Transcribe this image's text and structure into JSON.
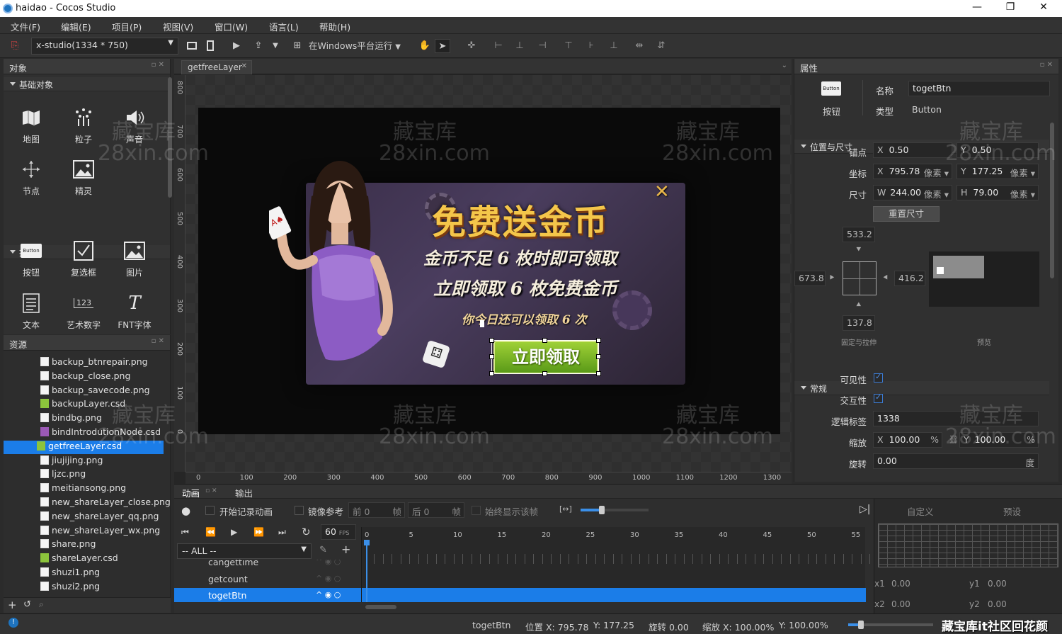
{
  "window": {
    "title": "haidao - Cocos Studio"
  },
  "menu": [
    "文件(F)",
    "编辑(E)",
    "项目(P)",
    "视图(V)",
    "窗口(W)",
    "语言(L)",
    "帮助(H)"
  ],
  "toolbar": {
    "resolution": "x-studio(1334 * 750)",
    "run_target": "在Windows平台运行"
  },
  "objects_panel": {
    "title": "对象",
    "basic_section": "基础对象",
    "basic_items": [
      "地图",
      "粒子",
      "声音",
      "节点",
      "精灵"
    ],
    "controls_section": "控件",
    "control_items": [
      "按钮",
      "复选框",
      "图片",
      "文本",
      "艺术数字",
      "FNT字体"
    ],
    "button_icon_text": "Button",
    "artnum_icon_text": "123"
  },
  "resources_panel": {
    "title": "资源",
    "files": [
      {
        "name": "backup_btnrepair.png",
        "type": "png"
      },
      {
        "name": "backup_close.png",
        "type": "png"
      },
      {
        "name": "backup_savecode.png",
        "type": "png"
      },
      {
        "name": "backupLayer.csd",
        "type": "csd"
      },
      {
        "name": "bindbg.png",
        "type": "png"
      },
      {
        "name": "bindIntrodutionNode.csd",
        "type": "csdp"
      },
      {
        "name": "getfreeLayer.csd",
        "type": "csd",
        "selected": true
      },
      {
        "name": "jiujijing.png",
        "type": "png"
      },
      {
        "name": "ljzc.png",
        "type": "png"
      },
      {
        "name": "meitiansong.png",
        "type": "png"
      },
      {
        "name": "new_shareLayer_close.png",
        "type": "png"
      },
      {
        "name": "new_shareLayer_qq.png",
        "type": "png"
      },
      {
        "name": "new_shareLayer_wx.png",
        "type": "png"
      },
      {
        "name": "share.png",
        "type": "png"
      },
      {
        "name": "shareLayer.csd",
        "type": "csd"
      },
      {
        "name": "shuzi1.png",
        "type": "png"
      },
      {
        "name": "shuzi2.png",
        "type": "png"
      }
    ]
  },
  "editor": {
    "tab": "getfreeLayer",
    "ruler_x": [
      "0",
      "100",
      "200",
      "300",
      "400",
      "500",
      "600",
      "700",
      "800",
      "900",
      "1000",
      "1100",
      "1200",
      "1300"
    ],
    "ruler_y": [
      "800",
      "700",
      "600",
      "500",
      "400",
      "300",
      "200",
      "100",
      "0"
    ],
    "popup": {
      "title": "免费送金币",
      "line1": "金币不足 6 枚时即可领取",
      "line2": "立即领取 6 枚免费金币",
      "line3": "你今日还可以领取 6 次",
      "button": "立即领取",
      "close": "✕"
    }
  },
  "watermark": {
    "line1": "藏宝库",
    "line2": "28xin.com"
  },
  "properties": {
    "title": "属性",
    "icon_text": "Button",
    "icon_label": "按钮",
    "name_label": "名称",
    "name_value": "togetBtn",
    "type_label": "类型",
    "type_value": "Button",
    "pos_section": "位置与尺寸",
    "anchor_label": "锚点",
    "anchor_x": "0.50",
    "anchor_y": "0.50",
    "pos_label": "坐标",
    "pos_x": "795.78",
    "pos_y": "177.25",
    "size_label": "尺寸",
    "size_w": "244.00",
    "size_h": "79.00",
    "unit": "像素",
    "reset_size": "重置尺寸",
    "margin_top": "533.2",
    "margin_left": "673.8",
    "margin_right": "416.2",
    "margin_bottom": "137.8",
    "fixed_label": "固定与拉伸",
    "preview_label": "预览",
    "general_section": "常规",
    "visible_label": "可见性",
    "interactive_label": "交互性",
    "tag_label": "逻辑标签",
    "tag_value": "1338",
    "scale_label": "缩放",
    "scale_x": "100.00",
    "scale_y": "100.00",
    "percent": "%",
    "rotate_label": "旋转",
    "rotate_value": "0.00",
    "degree": "度"
  },
  "animation": {
    "tab1": "动画",
    "tab2": "输出",
    "record": "开始记录动画",
    "mirror": "镜像参考",
    "prev_label": "前",
    "prev_value": "0",
    "next_label": "后",
    "next_value": "0",
    "frame_unit": "帧",
    "always_show": "始终显示该帧",
    "fps": "60",
    "fps_unit": "FPS",
    "filter": "-- ALL --",
    "frames": [
      "0",
      "5",
      "10",
      "15",
      "20",
      "25",
      "30",
      "35",
      "40",
      "45",
      "50",
      "55"
    ],
    "tracks": [
      "cangettime",
      "getcount",
      "togetBtn"
    ],
    "custom_tab": "自定义",
    "preset_tab": "预设",
    "x1": "0.00",
    "y1": "0.00",
    "x2": "0.00",
    "y2": "0.00"
  },
  "status": {
    "node": "togetBtn",
    "pos": "位置 X: 795.78",
    "pos_y": "Y: 177.25",
    "rot": "旋转 0.00",
    "scale": "缩放 X: 100.00%",
    "scale_y": "Y: 100.00%",
    "footer_mark": "藏宝库it社区回花颜"
  }
}
